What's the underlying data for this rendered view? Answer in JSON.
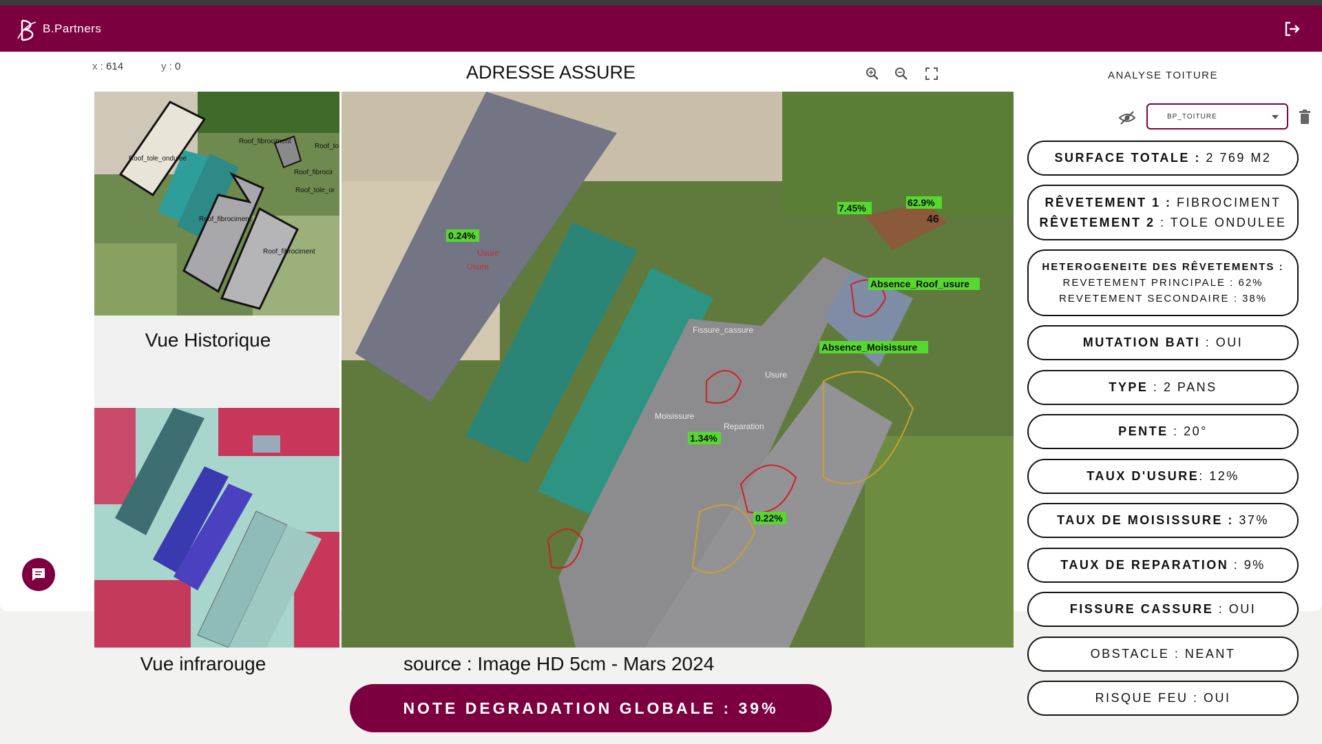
{
  "header": {
    "brand": "B.Partners"
  },
  "toolbar": {
    "x_label": "x :",
    "x_value": "614",
    "y_label": "y :",
    "y_value": "0",
    "title": "ADRESSE ASSURE"
  },
  "views": {
    "historique": "Vue Historique",
    "infrarouge": "Vue infrarouge",
    "source": "source : Image HD 5cm - Mars 2024"
  },
  "historique_labels": [
    "Roof_fibrociment",
    "Roof_tole_ondulee",
    "Roof_to",
    "Roof_fibrocir",
    "Roof_tole_or",
    "Roof_fibrociment",
    "Roof_fibrociment"
  ],
  "main_labels": {
    "pct_1": "0.24%",
    "usure_1": "Usure",
    "usure_2": "Usure",
    "pct_2": "7.45%",
    "pct_3": "62.9%",
    "num_46": "46",
    "absence_roof": "Absence_Roof_usure",
    "absence_moisissure": "Absence_Moisissure",
    "pct_4": "1.34%",
    "pct_5": "0.22%",
    "fissure_1": "Fissure_cassure",
    "reparation_1": "Reparation",
    "moisissure_1": "Moisissure",
    "usure_3": "Usure"
  },
  "note": "NOTE DEGRADATION GLOBALE : 39%",
  "panel": {
    "tab": "ANALYSE TOITURE",
    "select_value": "BP_TOITURE",
    "items": [
      {
        "key": "SURFACE TOTALE :",
        "val": " 2 769 M2"
      },
      {
        "key": "RÊVETEMENT 1 :",
        "val": " FIBROCIMENT"
      },
      {
        "key": "RÊVETEMENT 2",
        "val": " : TOLE ONDULEE"
      },
      {
        "key": "HETEROGENEITE DES RÊVETEMENTS :",
        "val": ""
      },
      {
        "key": "",
        "val": "REVETEMENT PRINCIPALE : 62%"
      },
      {
        "key": "",
        "val": "REVETEMENT SECONDAIRE : 38%"
      },
      {
        "key": "MUTATION BATI",
        "val": " : OUI"
      },
      {
        "key": "TYPE",
        "val": " : 2 PANS"
      },
      {
        "key": "PENTE",
        "val": " : 20°"
      },
      {
        "key": "TAUX D'USURE",
        "val": ": 12%"
      },
      {
        "key": "TAUX DE MOISISSURE :",
        "val": " 37%"
      },
      {
        "key": "TAUX DE REPARATION",
        "val": " : 9%"
      },
      {
        "key": "FISSURE CASSURE",
        "val": " : OUI"
      },
      {
        "key": "",
        "val": "OBSTACLE : NEANT"
      },
      {
        "key": "",
        "val": "RISQUE FEU : OUI"
      }
    ]
  },
  "colors": {
    "brand": "#7c0040"
  }
}
